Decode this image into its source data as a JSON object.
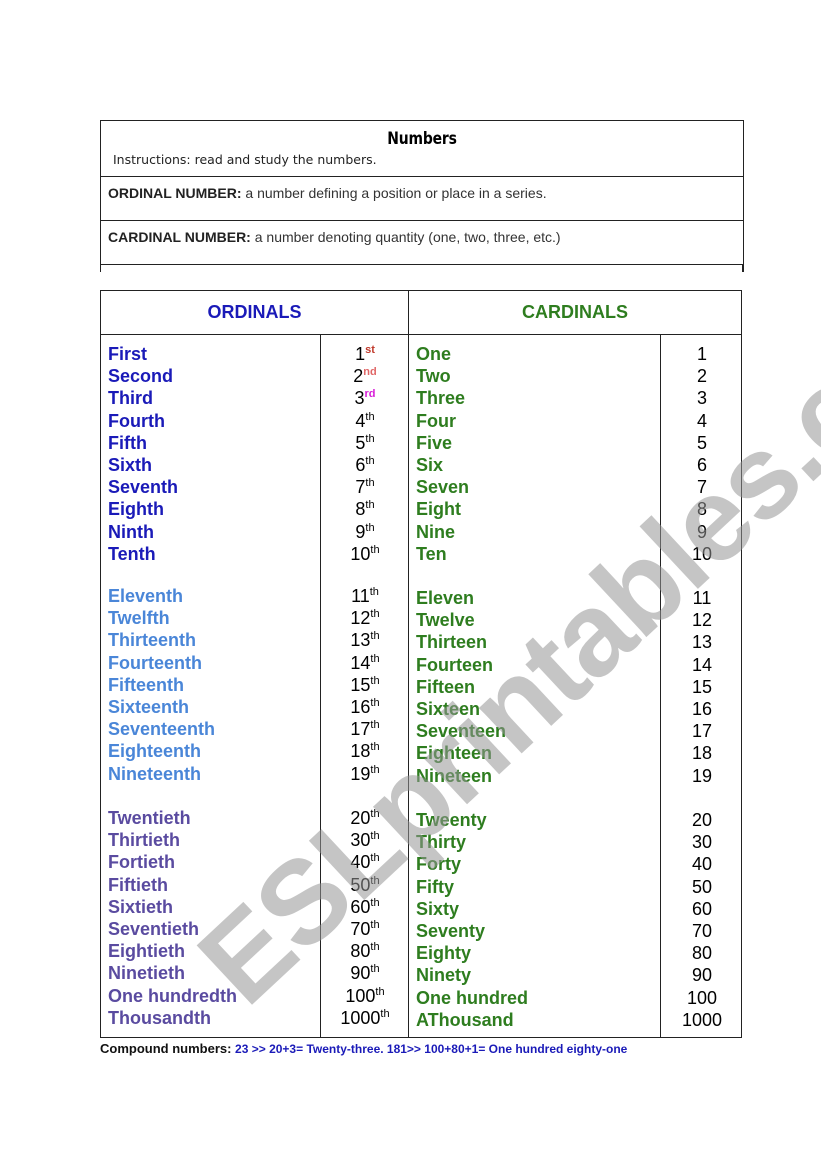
{
  "document": {
    "title": "Numbers",
    "instructions": "Instructions: read and study the numbers.",
    "definitions": [
      {
        "term": "ORDINAL NUMBER:",
        "text": " a number defining a position or place  in a series."
      },
      {
        "term": "CARDINAL NUMBER:",
        "text": " a number denoting quantity (one, two, three, etc.)"
      }
    ]
  },
  "table": {
    "ordinals_header": "ORDINALS",
    "cardinals_header": "CARDINALS",
    "colors": {
      "ordinal_group1": "#1a1ab8",
      "ordinal_group2": "#4a86d8",
      "ordinal_group3": "#5a4ba0",
      "cardinal": "#2e7d1f",
      "suffix_st": "#c0392b",
      "suffix_nd": "#e06666",
      "suffix_rd": "#d81bd8"
    },
    "groups": [
      {
        "rows": [
          {
            "ordinal": "First",
            "num": "1",
            "suffix": "st",
            "cardinal": "One",
            "value": "1"
          },
          {
            "ordinal": "Second",
            "num": "2",
            "suffix": "nd",
            "cardinal": "Two",
            "value": "2"
          },
          {
            "ordinal": "Third",
            "num": "3",
            "suffix": "rd",
            "cardinal": "Three",
            "value": "3"
          },
          {
            "ordinal": "Fourth",
            "num": "4",
            "suffix": "th",
            "cardinal": "Four",
            "value": "4"
          },
          {
            "ordinal": "Fifth",
            "num": "5",
            "suffix": "th",
            "cardinal": "Five",
            "value": "5"
          },
          {
            "ordinal": "Sixth",
            "num": "6",
            "suffix": "th",
            "cardinal": "Six",
            "value": "6"
          },
          {
            "ordinal": "Seventh",
            "num": "7",
            "suffix": "th",
            "cardinal": "Seven",
            "value": "7"
          },
          {
            "ordinal": "Eighth",
            "num": "8",
            "suffix": "th",
            "cardinal": "Eight",
            "value": "8"
          },
          {
            "ordinal": "Ninth",
            "num": "9",
            "suffix": "th",
            "cardinal": "Nine",
            "value": "9"
          },
          {
            "ordinal": "Tenth",
            "num": "10",
            "suffix": "th",
            "cardinal": "Ten",
            "value": "10"
          }
        ]
      },
      {
        "rows": [
          {
            "ordinal": "Eleventh",
            "num": "11",
            "suffix": "th",
            "cardinal": "Eleven",
            "value": "11"
          },
          {
            "ordinal": "Twelfth",
            "num": "12",
            "suffix": "th",
            "cardinal": "Twelve",
            "value": "12"
          },
          {
            "ordinal": "Thirteenth",
            "num": "13",
            "suffix": "th",
            "cardinal": "Thirteen",
            "value": "13"
          },
          {
            "ordinal": "Fourteenth",
            "num": "14",
            "suffix": "th",
            "cardinal": "Fourteen",
            "value": "14"
          },
          {
            "ordinal": "Fifteenth",
            "num": "15",
            "suffix": "th",
            "cardinal": "Fifteen",
            "value": "15"
          },
          {
            "ordinal": "Sixteenth",
            "num": "16",
            "suffix": "th",
            "cardinal": "Sixteen",
            "value": "16"
          },
          {
            "ordinal": "Seventeenth",
            "num": "17",
            "suffix": "th",
            "cardinal": "Seventeen",
            "value": "17"
          },
          {
            "ordinal": "Eighteenth",
            "num": "18",
            "suffix": "th",
            "cardinal": "Eighteen",
            "value": "18"
          },
          {
            "ordinal": "Nineteenth",
            "num": "19",
            "suffix": "th",
            "cardinal": "Nineteen",
            "value": "19"
          }
        ]
      },
      {
        "rows": [
          {
            "ordinal": "Twentieth",
            "num": "20",
            "suffix": "th",
            "cardinal": "Tweenty",
            "value": "20"
          },
          {
            "ordinal": "Thirtieth",
            "num": "30",
            "suffix": "th",
            "cardinal": "Thirty",
            "value": "30"
          },
          {
            "ordinal": "Fortieth",
            "num": "40",
            "suffix": "th",
            "cardinal": "Forty",
            "value": "40"
          },
          {
            "ordinal": "Fiftieth",
            "num": "50",
            "suffix": "th",
            "cardinal": "Fifty",
            "value": "50"
          },
          {
            "ordinal": "Sixtieth",
            "num": "60",
            "suffix": "th",
            "cardinal": "Sixty",
            "value": "60"
          },
          {
            "ordinal": "Seventieth",
            "num": "70",
            "suffix": "th",
            "cardinal": "Seventy",
            "value": "70"
          },
          {
            "ordinal": "Eightieth",
            "num": "80",
            "suffix": "th",
            "cardinal": "Eighty",
            "value": "80"
          },
          {
            "ordinal": "Ninetieth",
            "num": "90",
            "suffix": "th",
            "cardinal": "Ninety",
            "value": "90"
          },
          {
            "ordinal": "One hundredth",
            "num": "100",
            "suffix": "th",
            "cardinal": "One hundred",
            "value": "100"
          },
          {
            "ordinal": "Thousandth",
            "num": "1000",
            "suffix": "th",
            "cardinal": "AThousand",
            "value": "1000"
          }
        ]
      }
    ]
  },
  "footer": {
    "label": "Compound numbers: ",
    "examples": "23 >> 20+3= Twenty-three.  181>> 100+80+1= One hundred eighty-one"
  },
  "watermark": "ESLprintables.com"
}
